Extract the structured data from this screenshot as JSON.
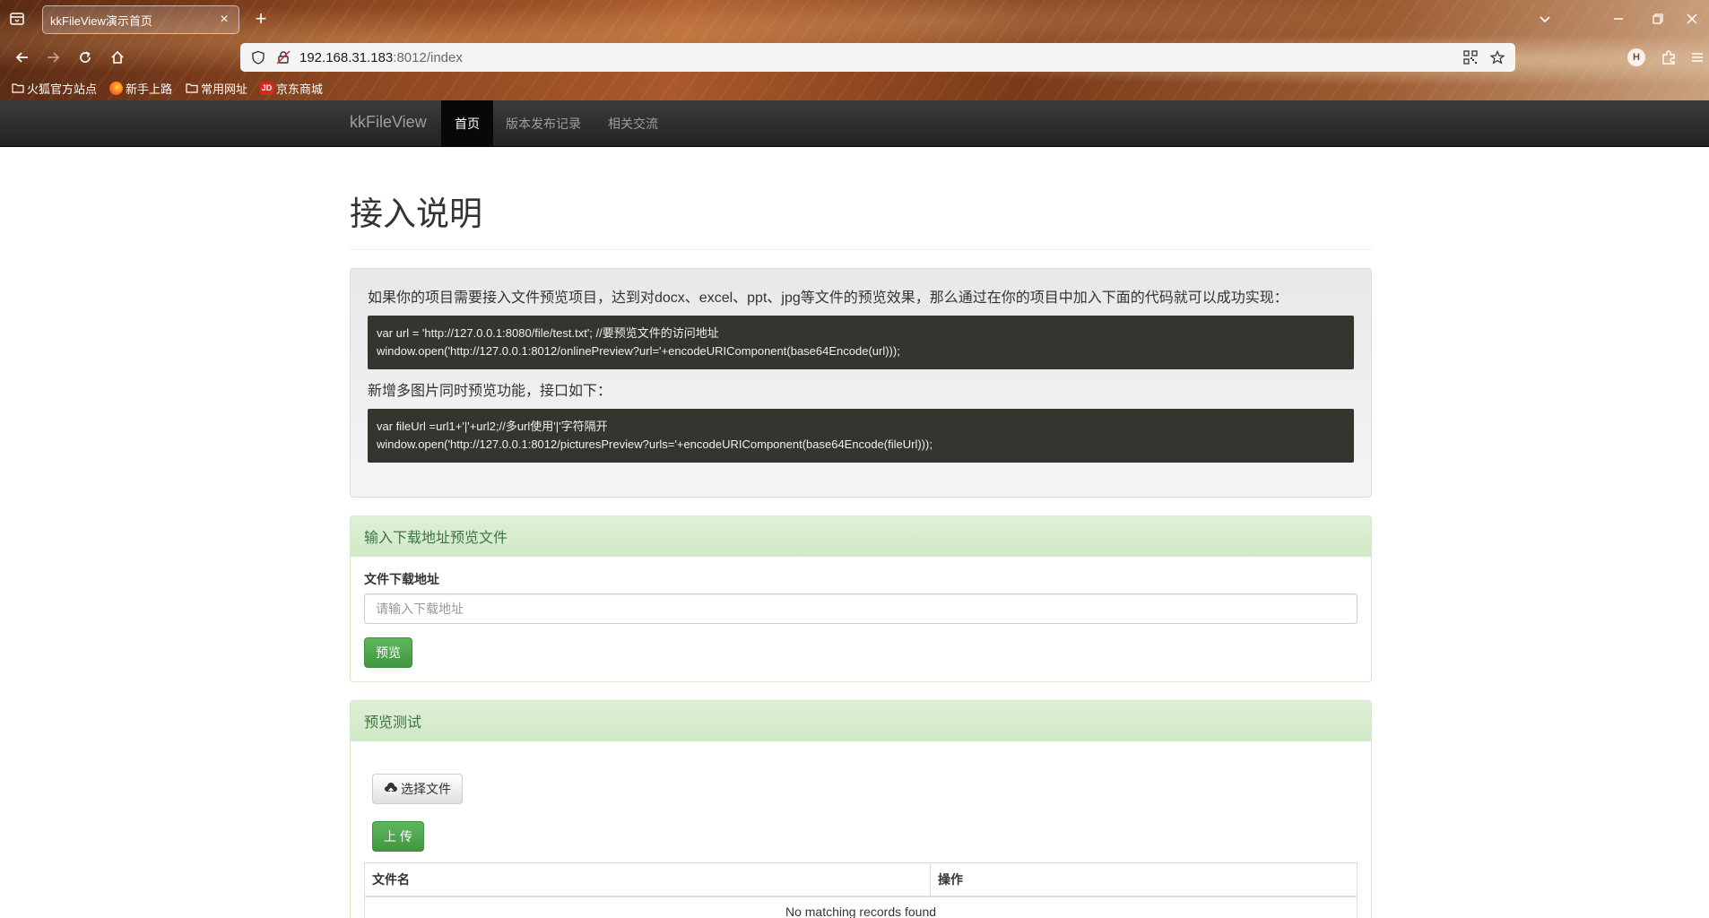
{
  "browser": {
    "tab_title": "kkFileView演示首页",
    "url_host": "192.168.31.183",
    "url_path": ":8012/index",
    "bookmarks": [
      "火狐官方站点",
      "新手上路",
      "常用网址",
      "京东商城"
    ],
    "jd_icon_text": "JD",
    "profile_initial": "H"
  },
  "navbar": {
    "brand": "kkFileView",
    "items": [
      "首页",
      "版本发布记录",
      "相关交流"
    ]
  },
  "main": {
    "title": "接入说明",
    "intro": "如果你的项目需要接入文件预览项目，达到对docx、excel、ppt、jpg等文件的预览效果，那么通过在你的项目中加入下面的代码就可以成功实现：",
    "code1_line1": "var url = 'http://127.0.0.1:8080/file/test.txt'; //要预览文件的访问地址",
    "code1_line2": "window.open('http://127.0.0.1:8012/onlinePreview?url='+encodeURIComponent(base64Encode(url)));",
    "multi_intro": "新增多图片同时预览功能，接口如下：",
    "code2_line1": "var fileUrl =url1+'|'+url2;//多url使用'|'字符隔开",
    "code2_line2": "window.open('http://127.0.0.1:8012/picturesPreview?urls='+encodeURIComponent(base64Encode(fileUrl)));"
  },
  "url_panel": {
    "heading": "输入下载地址预览文件",
    "label": "文件下载地址",
    "placeholder": "请输入下载地址",
    "button": "预览"
  },
  "test_panel": {
    "heading": "预览测试",
    "choose_button": "选择文件",
    "upload_button": "上 传",
    "columns": [
      "文件名",
      "操作"
    ],
    "empty_text": "No matching records found"
  }
}
